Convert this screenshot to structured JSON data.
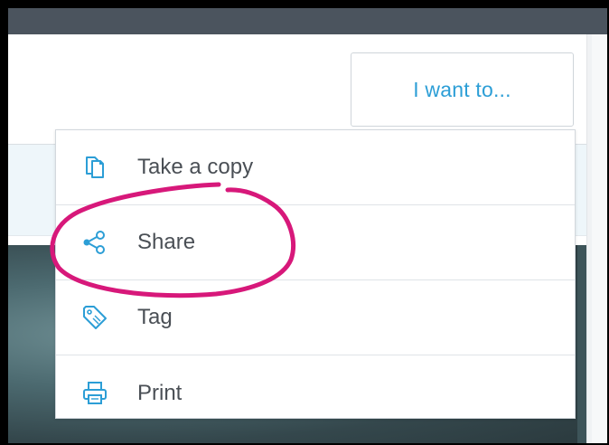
{
  "colors": {
    "topbar": "#4b545e",
    "accent": "#2c9ed6",
    "highlight": "#d7187a",
    "menu_text": "#4a4f55"
  },
  "header": {
    "want_button_label": "I want to..."
  },
  "menu": {
    "items": [
      {
        "label": "Take a copy",
        "icon": "copy-icon"
      },
      {
        "label": "Share",
        "icon": "share-icon"
      },
      {
        "label": "Tag",
        "icon": "tag-icon"
      },
      {
        "label": "Print",
        "icon": "print-icon"
      }
    ]
  }
}
